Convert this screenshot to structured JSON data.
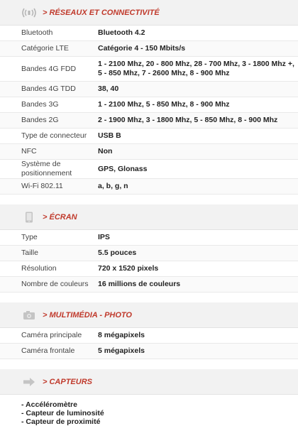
{
  "sections": [
    {
      "title": "> RÉSEAUX ET CONNECTIVITÉ",
      "icon": "wifi-signal-icon",
      "rows": [
        {
          "label": "Bluetooth",
          "value": "Bluetooth 4.2"
        },
        {
          "label": "Catégorie LTE",
          "value": "Catégorie 4 - 150 Mbits/s"
        },
        {
          "label": "Bandes 4G FDD",
          "value": "1 - 2100 Mhz, 20 - 800 Mhz, 28 - 700 Mhz, 3 - 1800 Mhz +, 5 - 850 Mhz, 7 - 2600 Mhz, 8 - 900 Mhz"
        },
        {
          "label": "Bandes 4G TDD",
          "value": "38, 40"
        },
        {
          "label": "Bandes 3G",
          "value": "1 - 2100 Mhz, 5 - 850 Mhz, 8 - 900 Mhz"
        },
        {
          "label": "Bandes 2G",
          "value": "2 - 1900 Mhz, 3 - 1800 Mhz, 5 - 850 Mhz, 8 - 900 Mhz"
        },
        {
          "label": "Type de connecteur",
          "value": "USB B"
        },
        {
          "label": "NFC",
          "value": "Non"
        },
        {
          "label": "Système de positionnement",
          "value": "GPS, Glonass"
        },
        {
          "label": "Wi-Fi 802.11",
          "value": "a, b, g, n"
        }
      ]
    },
    {
      "title": "> ÉCRAN",
      "icon": "phone-screen-icon",
      "rows": [
        {
          "label": "Type",
          "value": "IPS"
        },
        {
          "label": "Taille",
          "value": "5.5 pouces"
        },
        {
          "label": "Résolution",
          "value": "720 x 1520 pixels"
        },
        {
          "label": "Nombre de couleurs",
          "value": "16 millions de couleurs"
        }
      ]
    },
    {
      "title": "> MULTIMÉDIA - PHOTO",
      "icon": "camera-icon",
      "rows": [
        {
          "label": "Caméra principale",
          "value": "8 mégapixels"
        },
        {
          "label": "Caméra frontale",
          "value": "5 mégapixels"
        }
      ]
    },
    {
      "title": "> CAPTEURS",
      "icon": "arrow-right-icon",
      "bullets": [
        "- Accéléromètre",
        "- Capteur de luminosité",
        "- Capteur de proximité"
      ]
    }
  ],
  "colors": {
    "accent": "#c0392b",
    "header_bg": "#f2f2f2",
    "icon_gray": "#b5b5b5"
  }
}
